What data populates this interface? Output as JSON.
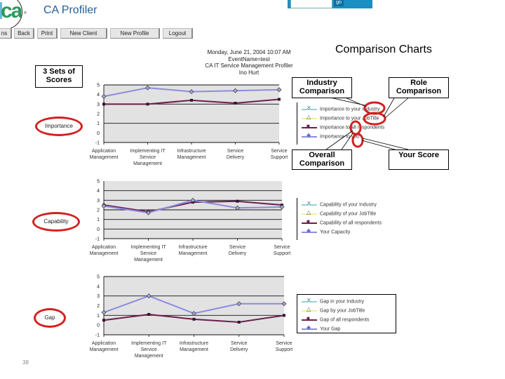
{
  "app": {
    "title": "CA Profiler",
    "logo_text": "ca",
    "registered_mark": "®",
    "search_placeholder": "",
    "go_label": "go",
    "brand_color": "#1f5e99",
    "searchbar_color": "#1a8fc4"
  },
  "nav": {
    "buttons": [
      {
        "label": "ns"
      },
      {
        "label": "Back"
      },
      {
        "label": "Print"
      },
      {
        "label": "New Client"
      },
      {
        "label": "New Profile"
      },
      {
        "label": "Logout"
      }
    ]
  },
  "page": {
    "title": "Comparison Charts",
    "header_lines": [
      "Monday, June 21, 2004 10:07 AM",
      "EventName=test",
      "CA IT Service Management Profiler",
      "Ino Hurt"
    ],
    "page_number": "38"
  },
  "callouts": {
    "three_sets": "3 Sets of Scores",
    "industry": "Industry Comparison",
    "role": "Role Comparison",
    "overall": "Overall Comparison",
    "your_score": "Your Score"
  },
  "section_labels": {
    "importance": "Importance",
    "capability": "Capability",
    "gap": "Gap"
  },
  "chart_data": [
    {
      "type": "line",
      "title": "Importance",
      "categories": [
        "Application Management",
        "Implementing IT Service Management",
        "Infrastructure Management",
        "Service Delivery",
        "Service Support"
      ],
      "ylim": [
        -1,
        5
      ],
      "yticks": [
        -1,
        0,
        1,
        2,
        3,
        4,
        5
      ],
      "grid": true,
      "series": [
        {
          "name": "Importance to your Industry",
          "color": "#9ad0d8",
          "values": [
            null,
            null,
            null,
            null,
            null
          ]
        },
        {
          "name": "Importance to your JobTitle",
          "color": "#f0f0a0",
          "values": [
            null,
            null,
            null,
            null,
            null
          ]
        },
        {
          "name": "Importance to all respondents",
          "color": "#6b1f4a",
          "values": [
            3.0,
            3.0,
            3.4,
            3.1,
            3.5
          ]
        },
        {
          "name": "Importance to you",
          "color": "#8c8ce0",
          "values": [
            3.8,
            4.7,
            4.3,
            4.4,
            4.5
          ]
        }
      ],
      "legend": "right"
    },
    {
      "type": "line",
      "title": "Capability",
      "categories": [
        "Application Management",
        "Implementing IT Service Management",
        "Infrastructure Management",
        "Service Delivery",
        "Service Support"
      ],
      "ylim": [
        -1,
        5
      ],
      "yticks": [
        -1,
        0,
        1,
        2,
        3,
        4,
        5
      ],
      "grid": true,
      "series": [
        {
          "name": "Capability of your Industry",
          "color": "#9ad0d8",
          "values": [
            null,
            null,
            null,
            null,
            null
          ]
        },
        {
          "name": "Capability of your JobTitle",
          "color": "#f0f0a0",
          "values": [
            null,
            null,
            null,
            null,
            null
          ]
        },
        {
          "name": "Capability of all respondents",
          "color": "#6b1f4a",
          "values": [
            2.5,
            1.8,
            2.8,
            2.9,
            2.5
          ]
        },
        {
          "name": "Your Capacity",
          "color": "#8c8ce0",
          "values": [
            2.4,
            1.7,
            3.0,
            2.2,
            2.3
          ]
        }
      ],
      "legend": "right"
    },
    {
      "type": "line",
      "title": "Gap",
      "categories": [
        "Application Management",
        "Implementing IT Service Management",
        "Infrastructure Management",
        "Service Delivery",
        "Service Support"
      ],
      "ylim": [
        -1,
        5
      ],
      "yticks": [
        -1,
        0,
        1,
        2,
        3,
        4,
        5
      ],
      "grid": true,
      "series": [
        {
          "name": "Gap in your Industry",
          "color": "#9ad0d8",
          "values": [
            null,
            null,
            null,
            null,
            null
          ]
        },
        {
          "name": "Gap by your JobTitle",
          "color": "#f0f0a0",
          "values": [
            null,
            null,
            null,
            null,
            null
          ]
        },
        {
          "name": "Gap of all respondents",
          "color": "#6b1f4a",
          "values": [
            0.5,
            1.1,
            0.6,
            0.3,
            1.0
          ]
        },
        {
          "name": "Your Gap",
          "color": "#8c8ce0",
          "values": [
            1.3,
            3.0,
            1.2,
            2.2,
            2.2
          ]
        }
      ],
      "legend": "right"
    }
  ]
}
